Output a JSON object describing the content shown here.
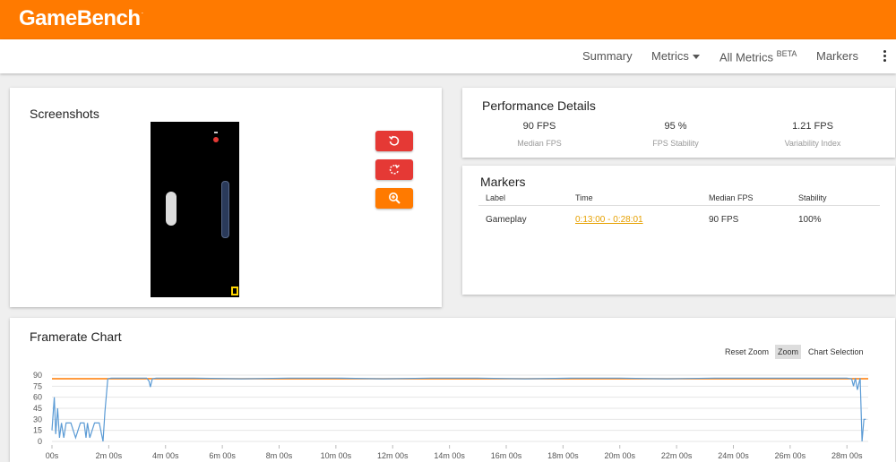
{
  "app": {
    "logo_text": "GameBench",
    "logo_mark": ".",
    "brand_color": "#ff7a00"
  },
  "nav": {
    "summary": "Summary",
    "metrics": "Metrics",
    "all_metrics": "All Metrics",
    "all_metrics_badge": "BETA",
    "markers": "Markers",
    "menu_icon": "kebab-menu-icon"
  },
  "screenshots": {
    "title": "Screenshots",
    "buttons": [
      {
        "icon": "rotate-left-icon",
        "color": "#e53935"
      },
      {
        "icon": "rotate-right-icon",
        "color": "#e53935"
      },
      {
        "icon": "zoom-in-icon",
        "color": "#ff7a00"
      }
    ]
  },
  "performance": {
    "title": "Performance Details",
    "metrics": [
      {
        "value": "90 FPS",
        "label": "Median FPS"
      },
      {
        "value": "95 %",
        "label": "FPS Stability"
      },
      {
        "value": "1.21 FPS",
        "label": "Variability Index"
      }
    ]
  },
  "markers": {
    "title": "Markers",
    "columns": [
      "Label",
      "Time",
      "Median FPS",
      "Stability"
    ],
    "rows": [
      {
        "label": "Gameplay",
        "time": "0:13:00 - 0:28:01",
        "median_fps": "90 FPS",
        "stability": "100%"
      }
    ]
  },
  "framerate": {
    "title": "Framerate Chart",
    "controls": {
      "reset_zoom": "Reset Zoom",
      "zoom": "Zoom",
      "chart_selection": "Chart Selection"
    },
    "line_color": "#5b9bd5",
    "median_line_color": "#ff7a00"
  },
  "chart_data": {
    "type": "line",
    "x_unit": "seconds",
    "xlim": [
      0,
      1725
    ],
    "ylim": [
      0,
      90
    ],
    "y_ticks": [
      "90",
      "75",
      "60",
      "45",
      "30",
      "15",
      "0"
    ],
    "x_tick_labels": [
      "00s",
      "2m 00s",
      "4m 00s",
      "6m 00s",
      "8m 00s",
      "10m 00s",
      "12m 00s",
      "14m 00s",
      "16m 00s",
      "18m 00s",
      "20m 00s",
      "22m 00s",
      "24m 00s",
      "26m 00s",
      "28m 00s"
    ],
    "x_tick_values": [
      0,
      120,
      240,
      360,
      480,
      600,
      720,
      840,
      960,
      1080,
      1200,
      1320,
      1440,
      1560,
      1680
    ],
    "median_fps": 90,
    "grid": true,
    "series": [
      {
        "x": [
          0,
          5,
          8,
          12,
          16,
          20,
          25,
          30,
          40,
          50,
          60,
          68,
          72,
          75,
          80,
          90,
          100,
          108,
          112,
          118,
          125,
          150,
          200,
          205,
          208,
          212,
          220,
          300,
          400,
          500,
          600,
          700,
          800,
          900,
          1000,
          1100,
          1200,
          1300,
          1400,
          1500,
          1600,
          1650,
          1680,
          1690,
          1694,
          1698,
          1702,
          1708,
          1712,
          1716,
          1720
        ],
        "y": [
          15,
          60,
          10,
          45,
          5,
          25,
          5,
          25,
          25,
          5,
          25,
          25,
          5,
          25,
          5,
          25,
          25,
          0,
          40,
          85,
          86,
          86,
          86,
          82,
          74,
          85,
          86,
          86,
          85,
          86,
          86,
          85,
          86,
          86,
          85,
          86,
          86,
          85,
          86,
          86,
          86,
          86,
          86,
          85,
          75,
          86,
          70,
          86,
          0,
          30,
          30
        ]
      }
    ]
  }
}
